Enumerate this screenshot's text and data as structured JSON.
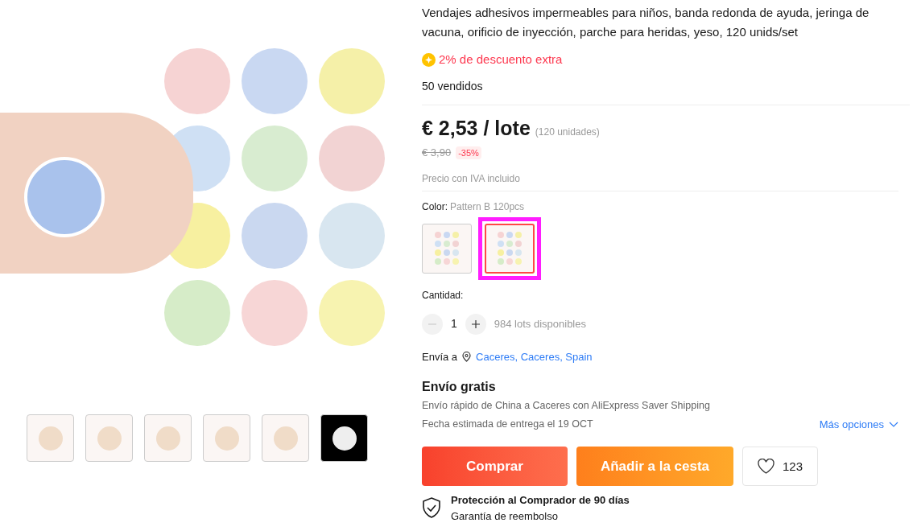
{
  "gallery": {
    "thumbnails": [
      {
        "selected": false
      },
      {
        "selected": false
      },
      {
        "selected": false
      },
      {
        "selected": false
      },
      {
        "selected": false
      },
      {
        "selected": false
      }
    ]
  },
  "product": {
    "title": "Vendajes adhesivos impermeables para niños, banda redonda de ayuda, jeringa de vacuna, orificio de inyección, parche para heridas, yeso, 120 unids/set",
    "extra_discount": "2% de descuento extra",
    "sold": "50 vendidos",
    "price": "€ 2,53 / lote",
    "units": "(120 unidades)",
    "old_price": "€ 3,90",
    "discount": "-35%",
    "tax_note": "Precio con IVA incluido"
  },
  "color": {
    "label": "Color:",
    "value": "Pattern B 120pcs",
    "options": [
      {
        "selected": false,
        "highlighted": false
      },
      {
        "selected": true,
        "highlighted": true
      }
    ]
  },
  "quantity": {
    "label": "Cantidad:",
    "value": "1",
    "minus_disabled": true,
    "available": "984 lots disponibles"
  },
  "shipping": {
    "label": "Envía a",
    "location": "Caceres, Caceres, Spain",
    "title": "Envío gratis",
    "details": "Envío rápido de China a Caceres con AliExpress Saver Shipping",
    "delivery": "Fecha estimada de entrega el 19 OCT",
    "more": "Más opciones"
  },
  "actions": {
    "buy": "Comprar",
    "cart": "Añadir a la cesta",
    "wishlist_count": "123"
  },
  "protection": {
    "title": "Protección al Comprador de 90 días",
    "subtitle": "Garantía de reembolso"
  }
}
